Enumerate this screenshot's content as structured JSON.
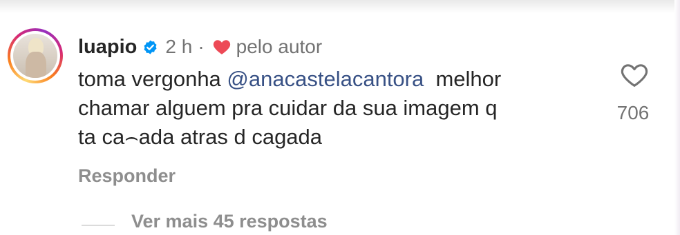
{
  "comment": {
    "username": "luapio",
    "verified_icon": "verified-badge-icon",
    "time": "2 h",
    "separator": "·",
    "liked_by_author_icon": "red-heart-icon",
    "liked_by_author_label": "pelo autor",
    "text_lines": [
      {
        "before": "toma vergonha ",
        "mention": "@anacastelacantora",
        "after": "  melhor"
      },
      {
        "text": "chamar alguem pra cuidar da sua imagem q"
      },
      {
        "text": "ta ca⌢ada atras d cagada"
      }
    ],
    "like_icon": "heart-outline-icon",
    "like_count": "706",
    "reply_label": "Responder",
    "view_more_label": "Ver mais 45 respostas"
  },
  "colors": {
    "text": "#262626",
    "secondary": "#737373",
    "mention": "#385185",
    "verified": "#0095f6",
    "heart_red": "#ed4956"
  }
}
